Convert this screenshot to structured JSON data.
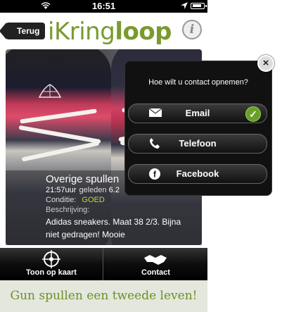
{
  "status_bar": {
    "time": "16:51"
  },
  "header": {
    "back_label": "Terug",
    "logo_prefix": "iKring",
    "logo_suffix": "loop",
    "info_label": "i"
  },
  "item": {
    "title": "Overige spullen",
    "time": "21:57uur",
    "time_ago": "geleden",
    "distance": "6.2",
    "condition_label": "Conditie:",
    "condition_value": "GOED",
    "description_label": "Beschrijving:",
    "description": "Adidas sneakers. Maat 38 2/3. Bijna niet gedragen! Mooie"
  },
  "tabs": [
    {
      "label": "Toon op kaart",
      "icon": "map-target-icon"
    },
    {
      "label": "Contact",
      "icon": "handshake-icon"
    }
  ],
  "footer": {
    "tagline": "Gun spullen een tweede leven!"
  },
  "contact_popup": {
    "question": "Hoe wilt u contact opnemen?",
    "options": [
      {
        "label": "Email",
        "icon": "envelope-icon",
        "selected": true
      },
      {
        "label": "Telefoon",
        "icon": "phone-icon",
        "selected": false
      },
      {
        "label": "Facebook",
        "icon": "facebook-icon",
        "selected": false
      }
    ]
  },
  "colors": {
    "brand_green": "#7a9a2e",
    "condition_good": "#c5d14a"
  }
}
